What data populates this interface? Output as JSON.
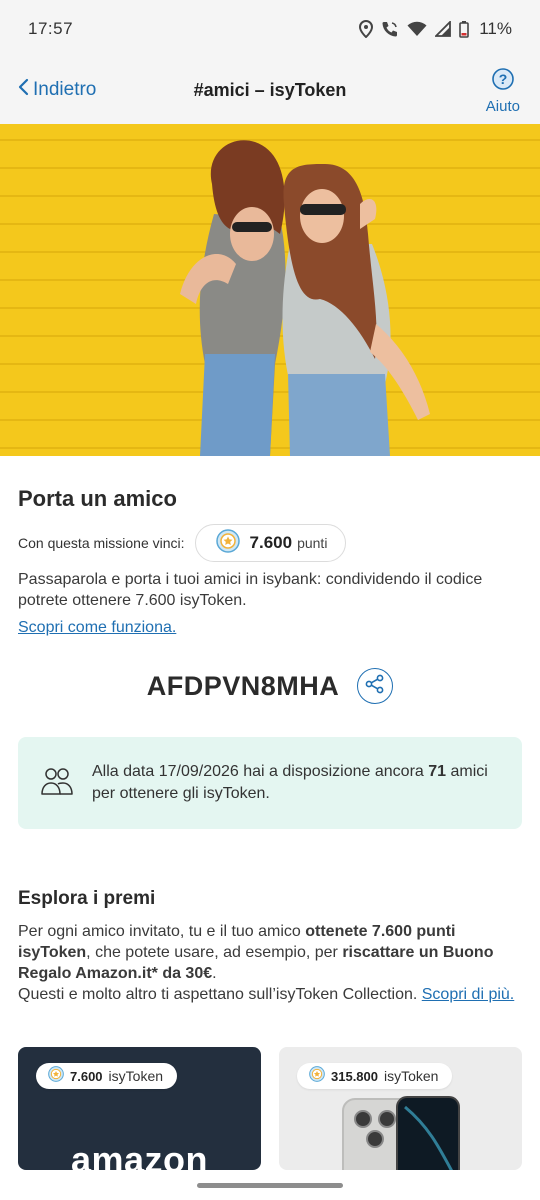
{
  "status": {
    "time": "17:57",
    "battery": "11%"
  },
  "nav": {
    "back_label": "Indietro",
    "title": "#amici – isyToken",
    "help_label": "Aiuto"
  },
  "mission": {
    "title": "Porta un amico",
    "label": "Con questa missione vinci:",
    "points_value": "7.600",
    "points_unit": "punti",
    "description": "Passaparola e porta i tuoi amici in isybank: condividendo il codice potrete ottenere 7.600 isyToken.",
    "learn_link": "Scopri come funziona."
  },
  "referral": {
    "code": "AFDPVN8MHA"
  },
  "info": {
    "text_before": "Alla data 17/09/2026 hai a disposizione ancora ",
    "count": "71",
    "text_after": " amici per ottenere gli isyToken."
  },
  "rewards": {
    "title": "Esplora i premi",
    "p1": "Per ogni amico invitato, tu e il tuo amico ",
    "p1_bold": "ottenete 7.600 punti isyToken",
    "p2": ", che potete usare, ad esempio, per ",
    "p2_bold": "riscattare un Buono Regalo Amazon.it* da 30€",
    "p3": ".",
    "p4": "Questi e molto altro ti aspettano sull’isyToken Collection. ",
    "link": "Scopri di più.",
    "cards": [
      {
        "value": "7.600",
        "unit": "isyToken",
        "brand": "amazon"
      },
      {
        "value": "315.800",
        "unit": "isyToken"
      }
    ]
  },
  "colors": {
    "accent": "#1f6fb2",
    "info_bg": "#e4f6f1",
    "hero_bg": "#f4c81c",
    "amazon_bg": "#232f3e"
  }
}
